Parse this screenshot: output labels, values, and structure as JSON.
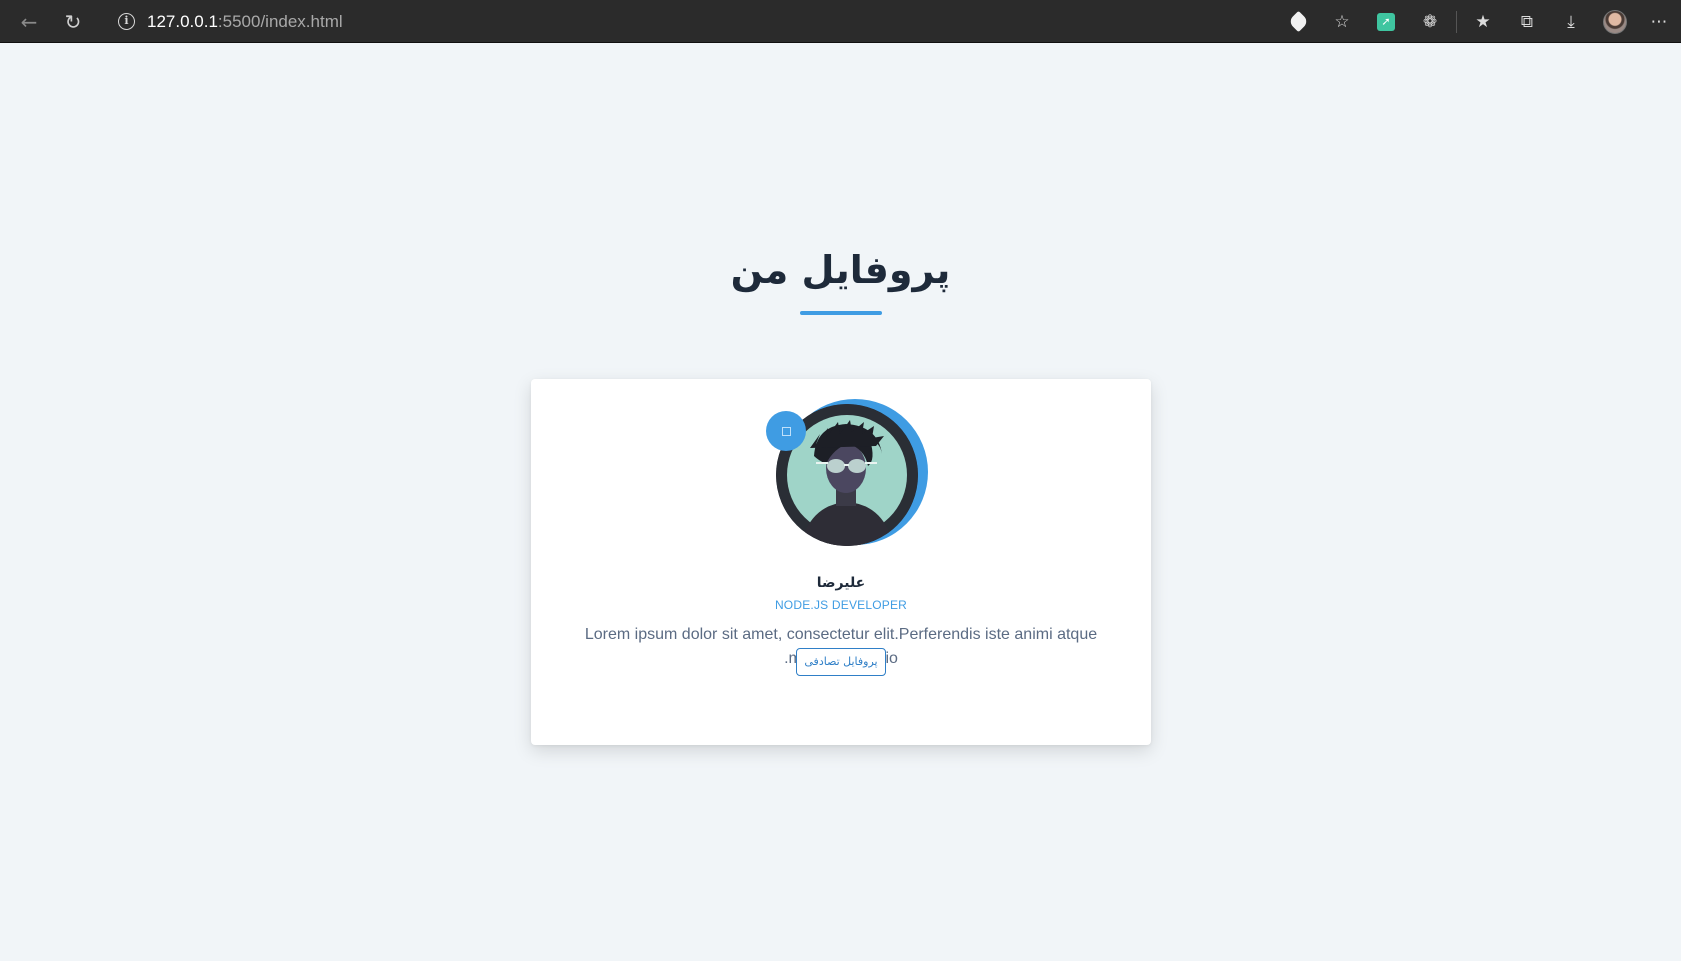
{
  "browser": {
    "url_host": "127.0.0.1",
    "url_rest": ":5500/index.html",
    "icons": {
      "back": "back-arrow-icon",
      "reload": "reload-icon",
      "site_info": "info-icon",
      "tag": "tag-icon",
      "add_favorite": "star-plus-icon",
      "extension": "green-extension-icon",
      "extensions": "puzzle-icon",
      "favorites": "favorites-icon",
      "collections": "collections-icon",
      "downloads": "download-icon",
      "profile": "profile-avatar",
      "menu": "more-icon"
    }
  },
  "page": {
    "title": "پروفایل من",
    "accent_color": "#3f9ce3"
  },
  "profile": {
    "name": "علیرضا",
    "role": "NODE.JS DEVELOPER",
    "bio": "Lorem ipsum dolor sit amet, consectetur elit.Perferendis iste animi atque minus distinctio.",
    "button_label": "پروفایل تصادفی"
  }
}
